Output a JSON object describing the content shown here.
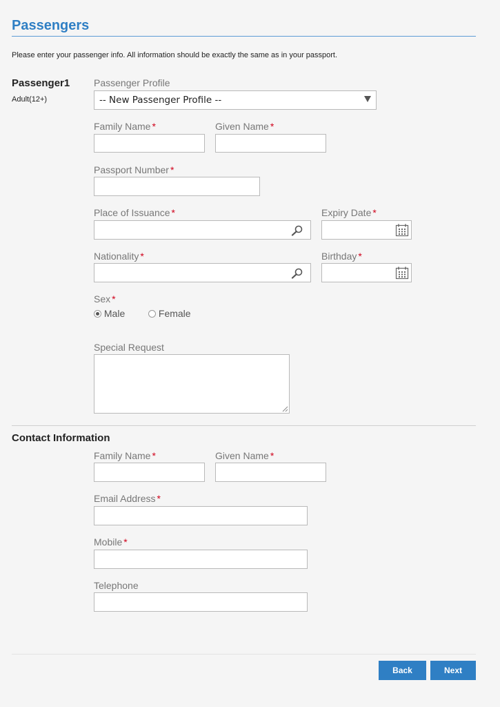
{
  "page": {
    "title": "Passengers",
    "intro": "Please enter your passenger info. All information should be exactly the same as in your passport."
  },
  "passenger": {
    "title": "Passenger1",
    "type": "Adult(12+)",
    "profile_label": "Passenger Profile",
    "profile_value": "-- New Passenger Profile --",
    "family_name_label": "Family Name",
    "given_name_label": "Given Name",
    "passport_label": "Passport Number",
    "issuance_label": "Place of Issuance",
    "expiry_label": "Expiry Date",
    "nationality_label": "Nationality",
    "birthday_label": "Birthday",
    "sex_label": "Sex",
    "sex_options": [
      "Male",
      "Female"
    ],
    "sex_selected": "Male",
    "special_request_label": "Special Request"
  },
  "contact": {
    "title": "Contact Information",
    "family_name_label": "Family Name",
    "given_name_label": "Given Name",
    "email_label": "Email Address",
    "mobile_label": "Mobile",
    "telephone_label": "Telephone"
  },
  "required_mark": "*",
  "buttons": {
    "back": "Back",
    "next": "Next"
  },
  "icons": {
    "search": "search-icon",
    "calendar": "calendar-icon",
    "dropdown": "chevron-down-icon"
  },
  "colors": {
    "accent": "#2f7fc4",
    "required": "#d0021b"
  }
}
